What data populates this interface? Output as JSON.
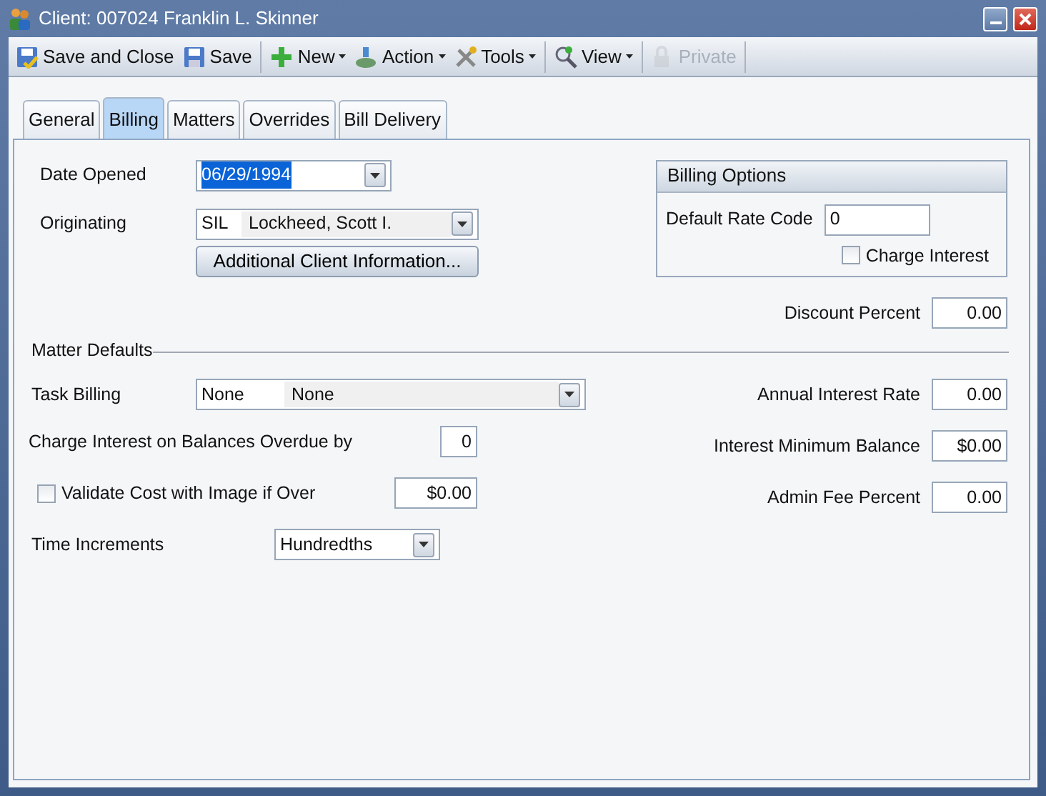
{
  "window": {
    "title": "Client: 007024 Franklin L. Skinner"
  },
  "toolbar_groups": [
    [
      {
        "kind": "save-close",
        "label": "Save and Close",
        "dropdown": false,
        "disabled": false
      },
      {
        "kind": "save",
        "label": "Save",
        "dropdown": false,
        "disabled": false
      }
    ],
    [
      {
        "kind": "new",
        "label": "New",
        "dropdown": true,
        "disabled": false
      },
      {
        "kind": "action",
        "label": "Action",
        "dropdown": true,
        "disabled": false
      },
      {
        "kind": "tools",
        "label": "Tools",
        "dropdown": true,
        "disabled": false
      }
    ],
    [
      {
        "kind": "view",
        "label": "View",
        "dropdown": true,
        "disabled": false
      }
    ],
    [
      {
        "kind": "private",
        "label": "Private",
        "dropdown": false,
        "disabled": true
      }
    ]
  ],
  "tabs": [
    {
      "label": "General",
      "selected": false
    },
    {
      "label": "Billing",
      "selected": true
    },
    {
      "label": "Matters",
      "selected": false
    },
    {
      "label": "Overrides",
      "selected": false
    },
    {
      "label": "Bill Delivery",
      "selected": false
    }
  ],
  "date_opened": {
    "label": "Date Opened",
    "value": "06/29/1994",
    "highlighted": true
  },
  "originating": {
    "label": "Originating",
    "code": "SIL",
    "name": "Lockheed, Scott I."
  },
  "additional_button": "Additional Client Information...",
  "billing_options": {
    "title": "Billing Options",
    "rate_label": "Default Rate Code",
    "rate_value": "0",
    "charge_interest": {
      "label": "Charge Interest",
      "checked": false
    }
  },
  "discount": {
    "label": "Discount Percent",
    "value": "0.00"
  },
  "matter_defaults": {
    "title": "Matter Defaults",
    "task_billing": {
      "label": "Task Billing",
      "code": "None",
      "name": "None"
    },
    "overdue": {
      "label": "Charge Interest on Balances Overdue by",
      "value": "0"
    },
    "validate": {
      "label": "Validate Cost with Image if Over",
      "checked": false,
      "value": "$0.00"
    },
    "time_increments": {
      "label": "Time Increments",
      "value": "Hundredths"
    },
    "annual_interest": {
      "label": "Annual Interest Rate",
      "value": "0.00"
    },
    "interest_minimum": {
      "label": "Interest Minimum Balance",
      "value": "$0.00"
    },
    "admin_fee": {
      "label": "Admin Fee Percent",
      "value": "0.00"
    }
  }
}
